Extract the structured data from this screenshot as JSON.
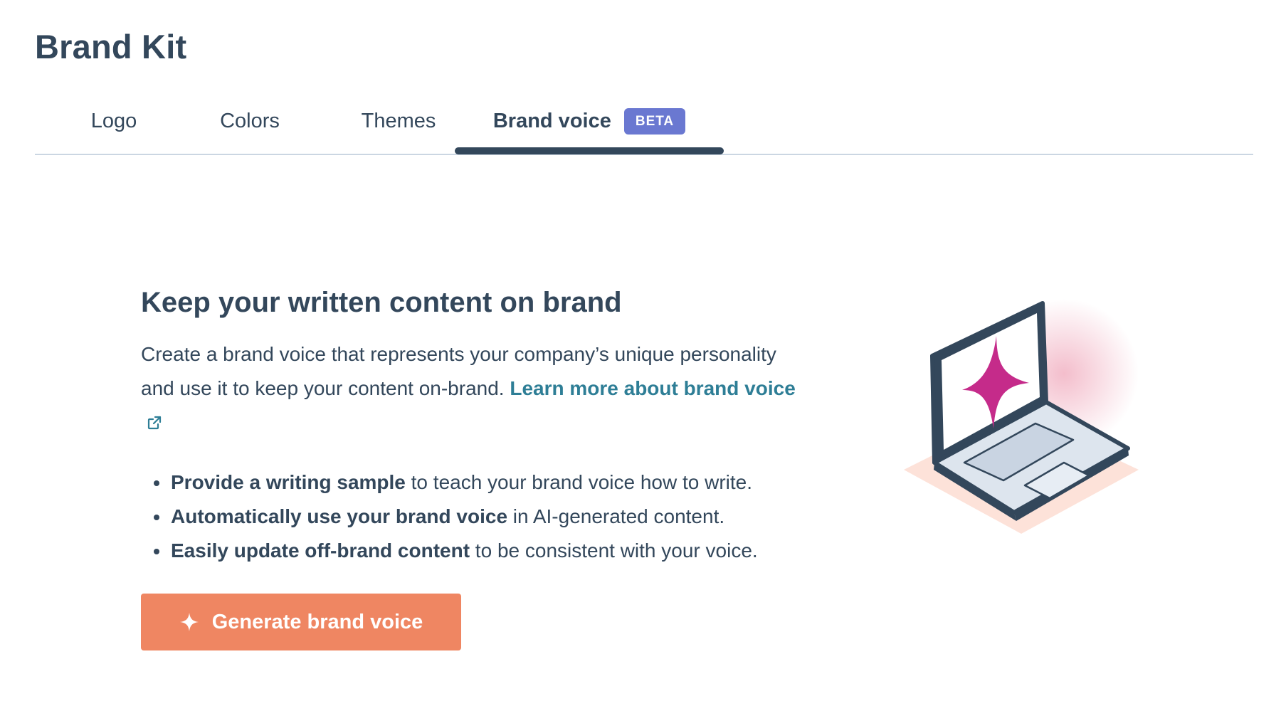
{
  "page": {
    "title": "Brand Kit"
  },
  "tabs": [
    {
      "label": "Logo"
    },
    {
      "label": "Colors"
    },
    {
      "label": "Themes"
    },
    {
      "label": "Brand voice",
      "badge": "BETA",
      "active": true
    }
  ],
  "main": {
    "heading": "Keep your written content on brand",
    "description": "Create a brand voice that represents your company’s unique personality and use it to keep your content on-brand.",
    "learn_more_link": "Learn more about brand voice",
    "bullets": [
      {
        "bold": "Provide a writing sample",
        "rest": " to teach your brand voice how to write."
      },
      {
        "bold": "Automatically use your brand voice",
        "rest": " in AI-generated content."
      },
      {
        "bold": "Easily update off-brand content",
        "rest": " to be consistent with your voice."
      }
    ],
    "button_label": "Generate brand voice"
  },
  "icons": {
    "learn_more": "external-link-icon",
    "button": "sparkle-icon",
    "illustration": "laptop-sparkle-illustration"
  },
  "colors": {
    "text": "#33475b",
    "link": "#2e7e96",
    "badge": "#6a78d1",
    "button": "#ef8662",
    "accent_sparkle": "#c52b8a"
  }
}
